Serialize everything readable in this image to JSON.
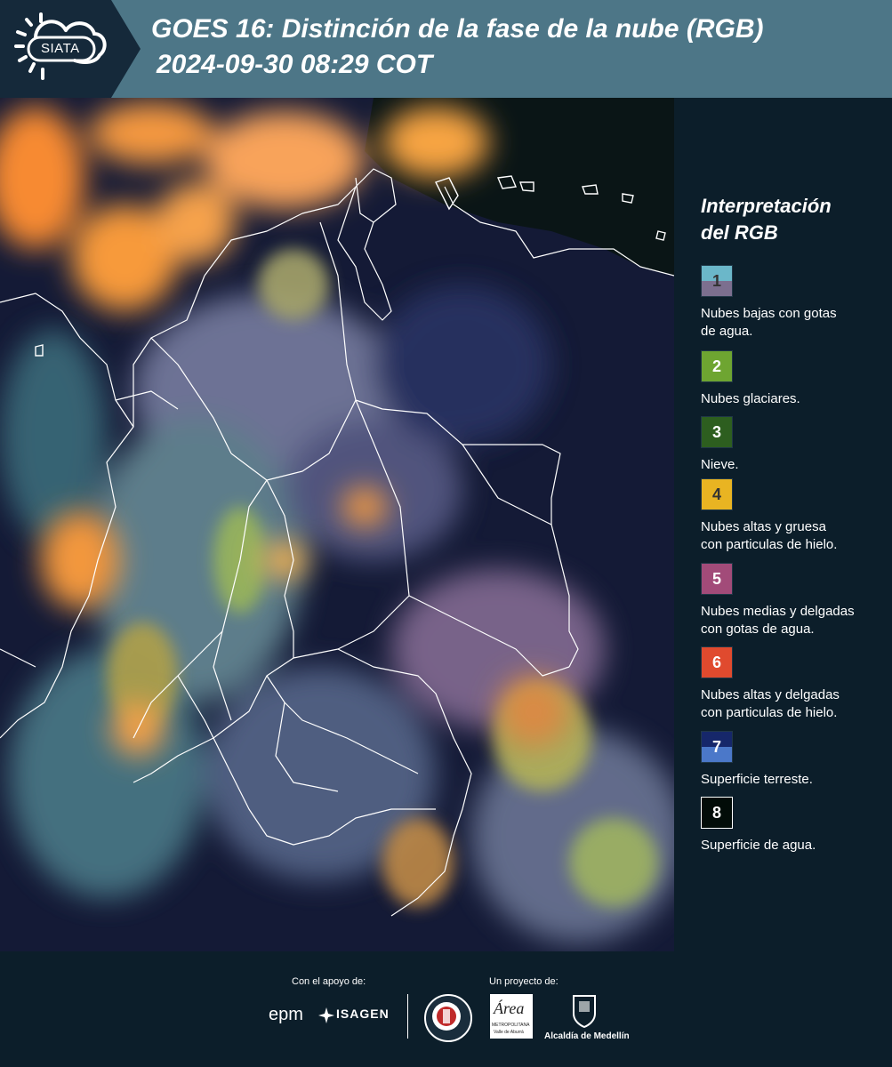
{
  "header": {
    "logo_text": "SIATA",
    "title_line1": "GOES 16: Distinción de la fase de la nube (RGB)",
    "title_line2": "2024-09-30 08:29 COT"
  },
  "legend": {
    "title_line1": "Interpretación",
    "title_line2": "del RGB",
    "items": [
      {
        "number": "1",
        "top_color": "#6bb7c9",
        "bottom_color": "#7c6f8f",
        "number_color": "#333333",
        "label_line1": "Nubes bajas con gotas",
        "label_line2": "de agua."
      },
      {
        "number": "2",
        "top_color": "#6ea531",
        "bottom_color": "#6ea531",
        "number_color": "#ffffff",
        "label_line1": "Nubes glaciares.",
        "label_line2": ""
      },
      {
        "number": "3",
        "top_color": "#2d5e1f",
        "bottom_color": "#2d5e1f",
        "number_color": "#ffffff",
        "label_line1": "Nieve.",
        "label_line2": ""
      },
      {
        "number": "4",
        "top_color": "#e9b422",
        "bottom_color": "#e9b422",
        "number_color": "#333333",
        "label_line1": "Nubes altas y gruesa",
        "label_line2": "con particulas de hielo."
      },
      {
        "number": "5",
        "top_color": "#a24b79",
        "bottom_color": "#a24b79",
        "number_color": "#ffffff",
        "label_line1": "Nubes medias y delgadas",
        "label_line2": "con gotas de agua."
      },
      {
        "number": "6",
        "top_color": "#e04a2e",
        "bottom_color": "#e04a2e",
        "number_color": "#ffffff",
        "label_line1": "Nubes altas y delgadas",
        "label_line2": "con particulas de hielo."
      },
      {
        "number": "7",
        "top_color": "#16276a",
        "bottom_color": "#4b78c9",
        "number_color": "#ffffff",
        "label_line1": "Superficie terreste.",
        "label_line2": ""
      },
      {
        "number": "8",
        "top_color": "#020c08",
        "bottom_color": "#020c08",
        "number_color": "#ffffff",
        "label_line1": "Superficie de agua.",
        "label_line2": ""
      }
    ]
  },
  "footer": {
    "support_label": "Con el apoyo de:",
    "project_label": "Un proyecto de:",
    "epm_logo": "epm",
    "isagen_logo": "ISAGEN",
    "area_logo_script": "Área",
    "area_logo_line1": "METROPOLITANA",
    "area_logo_line2": "Valle de Aburrá",
    "alcaldia_label": "Alcaldía de Medellín"
  }
}
